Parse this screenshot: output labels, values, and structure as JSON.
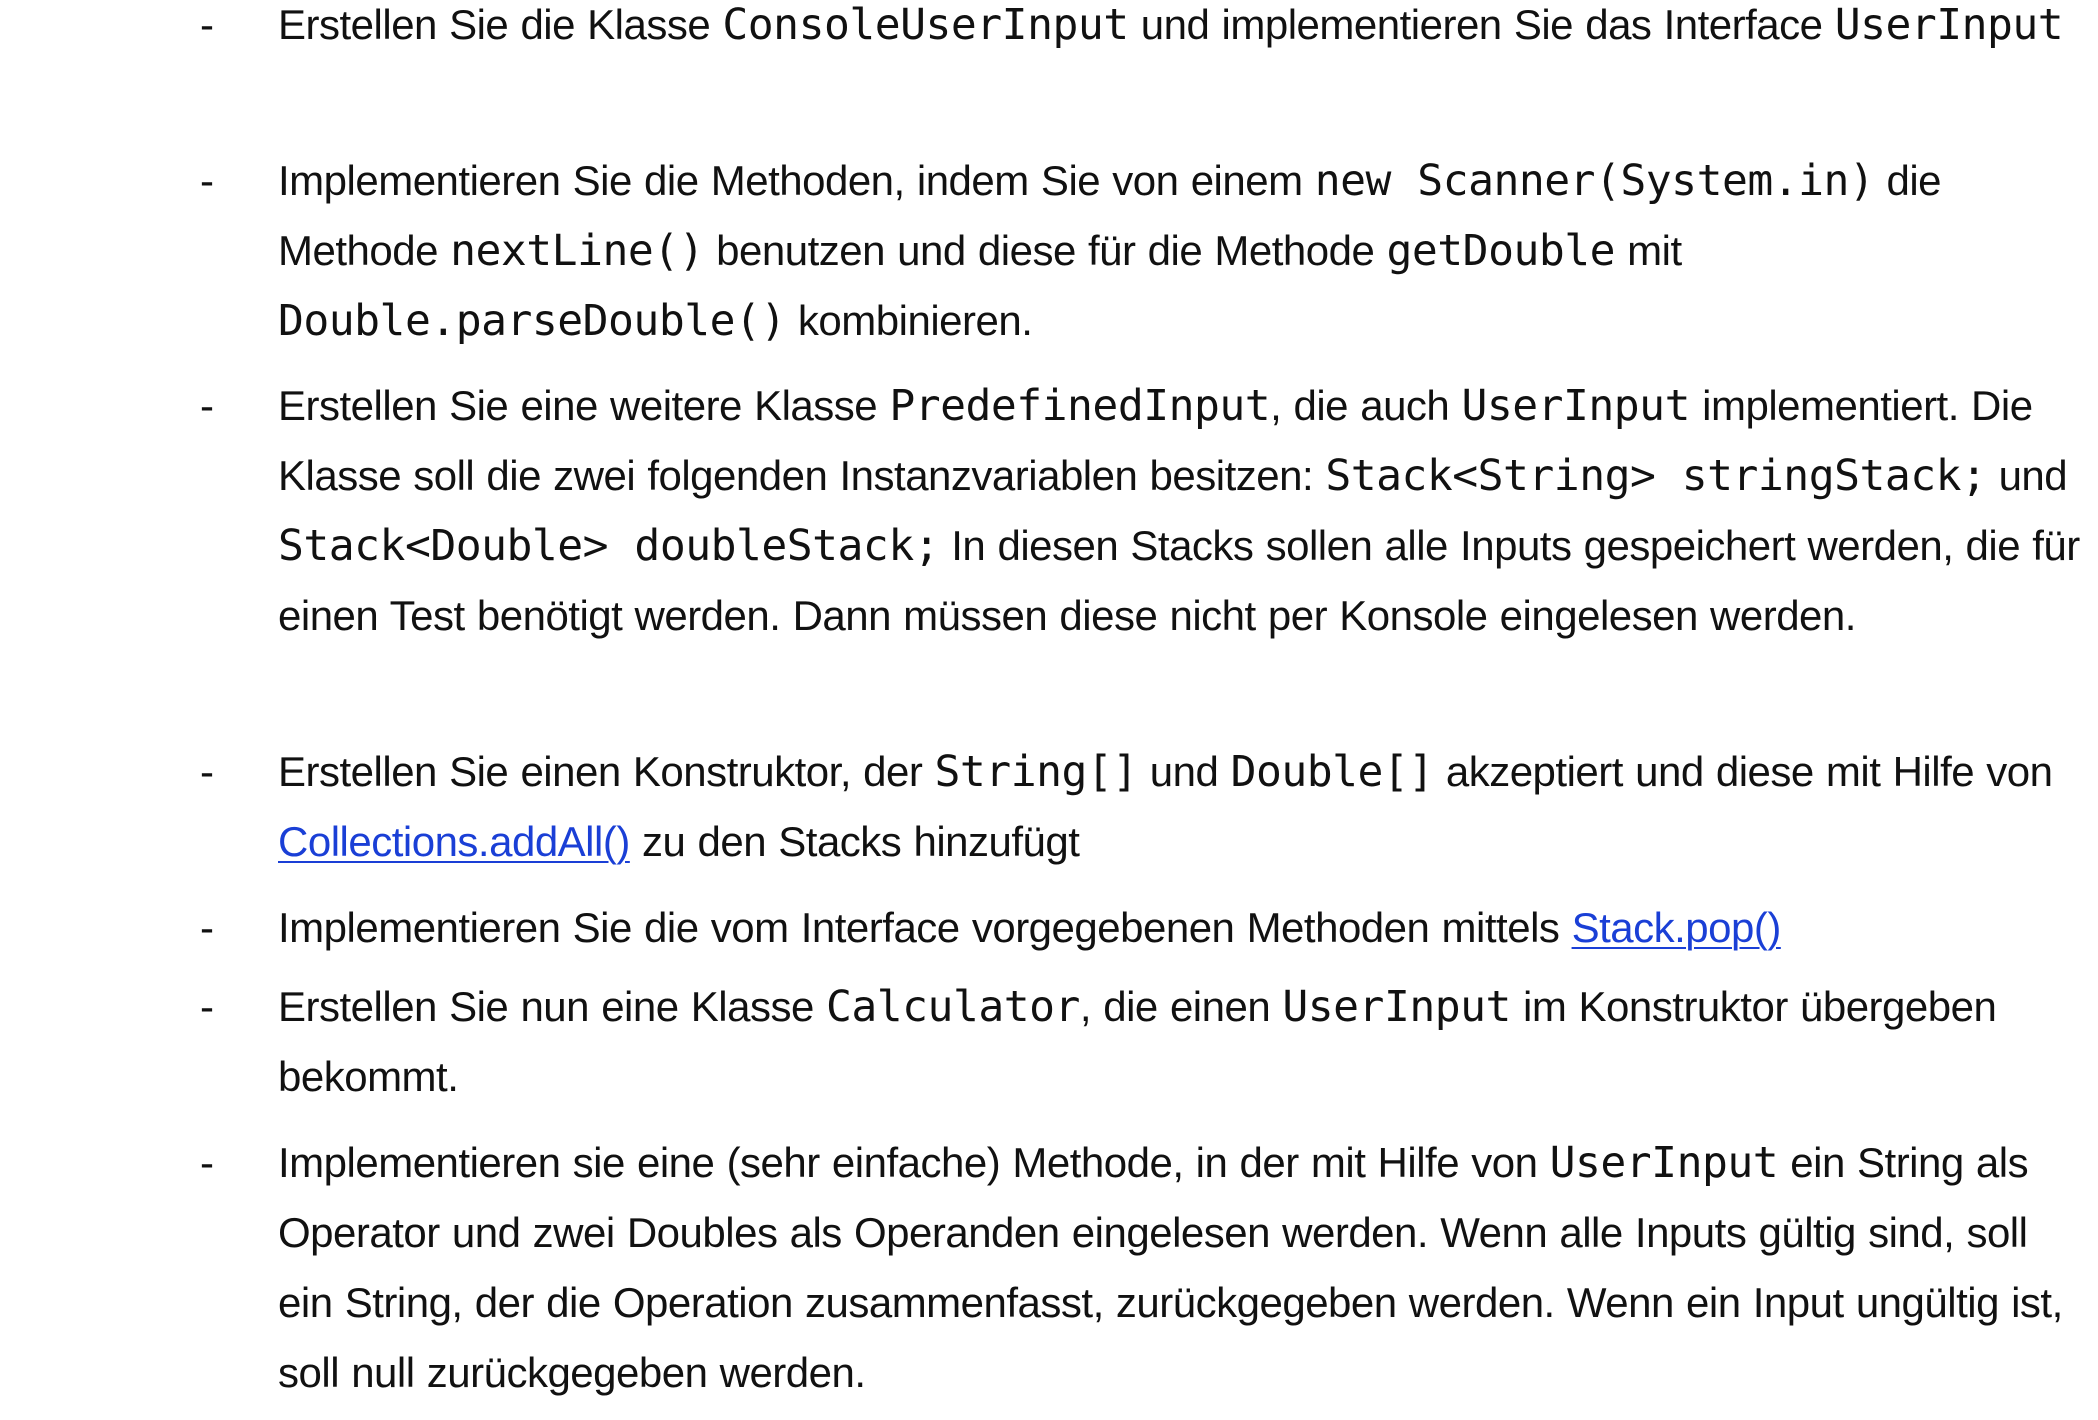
{
  "bullet_symbol": "-",
  "items": [
    {
      "t1": "Erstellen Sie die Klasse ",
      "c1": "ConsoleUserInput",
      "t2": " und implementieren Sie das Interface ",
      "c2": "UserInput"
    },
    {
      "t1": "Implementieren Sie die Methoden, indem Sie von einem ",
      "c1": "new Scanner(System.in)",
      "t2": " die Methode ",
      "c2": "nextLine()",
      "t3": " benutzen und diese für die Methode ",
      "c3": "getDouble",
      "t4": " mit ",
      "c4": "Double.parseDouble()",
      "t5": " kombinieren."
    },
    {
      "t1": "Erstellen Sie eine weitere Klasse ",
      "c1": "PredefinedInput",
      "t2": ", die auch ",
      "c2": "UserInput",
      "t3": " implementiert. Die Klasse soll die zwei folgenden Instanzvariablen besitzen: ",
      "c3": "Stack<String> stringStack;",
      "t4": " und ",
      "c4": "Stack<Double> doubleStack;",
      "t5": " In diesen Stacks sollen alle Inputs gespeichert werden, die für einen Test benötigt werden. Dann müssen diese nicht per Konsole eingelesen werden."
    },
    {
      "t1": "Erstellen Sie einen Konstruktor, der ",
      "c1": "String[]",
      "t2": " und ",
      "c2": "Double[]",
      "t3": " akzeptiert und diese mit Hilfe von ",
      "link": "Collections.addAll()",
      "t4": " zu den Stacks hinzufügt"
    },
    {
      "t1": "Implementieren Sie die vom Interface vorgegebenen Methoden mittels ",
      "link": "Stack.pop()"
    },
    {
      "t1": "Erstellen Sie nun eine Klasse ",
      "c1": "Calculator",
      "t2": ", die einen ",
      "c2": "UserInput",
      "t3": " im Konstruktor übergeben bekommt."
    },
    {
      "t1": "Implementieren sie eine (sehr einfache) Methode, in der mit Hilfe von ",
      "c1": "UserInput",
      "t2": " ein String als Operator und zwei Doubles als Operanden eingelesen werden. Wenn alle Inputs gültig sind, soll ein String, der die Operation zusammenfasst, zurückgegeben werden. Wenn ein Input ungültig ist, soll null zurückgegeben werden."
    }
  ]
}
